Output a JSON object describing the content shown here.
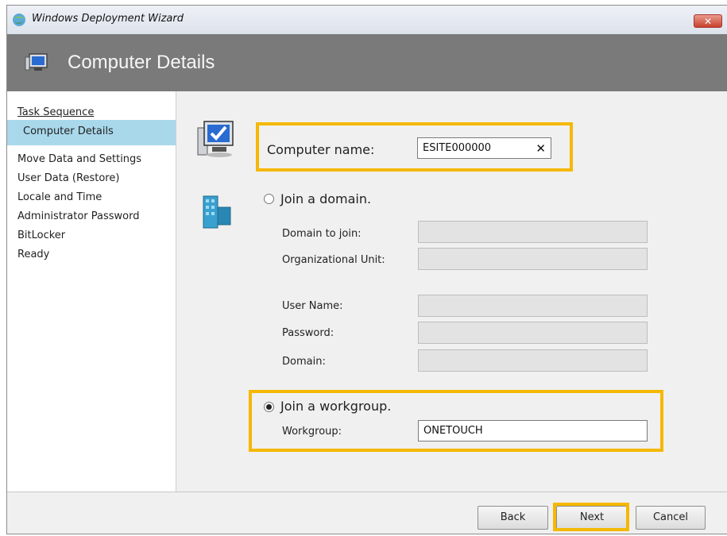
{
  "window": {
    "title": "Windows Deployment Wizard",
    "close_glyph": "✕"
  },
  "header": {
    "title": "Computer Details"
  },
  "nav": {
    "items": [
      {
        "label": "Task Sequence",
        "state": "link"
      },
      {
        "label": "Computer Details",
        "state": "selected"
      },
      {
        "label": "Move Data and Settings",
        "state": "normal"
      },
      {
        "label": "User Data (Restore)",
        "state": "normal"
      },
      {
        "label": "Locale and Time",
        "state": "normal"
      },
      {
        "label": "Administrator Password",
        "state": "normal"
      },
      {
        "label": "BitLocker",
        "state": "normal"
      },
      {
        "label": "Ready",
        "state": "normal"
      }
    ]
  },
  "computer_name": {
    "label": "Computer name:",
    "value": "ESITE000000",
    "clear_glyph": "✕"
  },
  "domain": {
    "radio_label": "Join a domain.",
    "selected": false,
    "fields": [
      {
        "label": "Domain to join:",
        "value": ""
      },
      {
        "label": "Organizational Unit:",
        "value": ""
      },
      {
        "label": "User Name:",
        "value": ""
      },
      {
        "label": "Password:",
        "value": ""
      },
      {
        "label": "Domain:",
        "value": ""
      }
    ]
  },
  "workgroup": {
    "radio_label": "Join a workgroup.",
    "selected": true,
    "label": "Workgroup:",
    "value": "ONETOUCH"
  },
  "buttons": {
    "back": "Back",
    "next": "Next",
    "cancel": "Cancel"
  },
  "colors": {
    "highlight": "#f5b800",
    "header_bg": "#7a7a7a",
    "nav_selected": "#a9d8eb"
  }
}
